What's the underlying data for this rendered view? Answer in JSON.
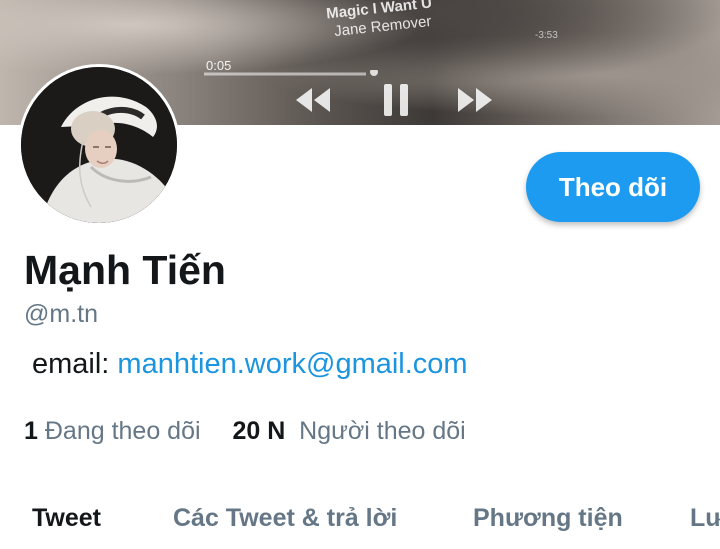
{
  "banner": {
    "song_title": "Magic I Want U",
    "song_artist": "Jane Remover",
    "time_elapsed": "0:05",
    "time_remaining": "-3:53"
  },
  "profile": {
    "name": "Mạnh Tiến",
    "handle": "@m.tn",
    "bio_prefix": "email: ",
    "bio_email": "manhtien.work@gmail.com",
    "follow_label": "Theo dõi"
  },
  "stats": {
    "following_count": "1",
    "following_label": "Đang theo dõi",
    "followers_count": "20 N",
    "followers_label": "Người theo dõi"
  },
  "tabs": [
    {
      "label": "Tweet"
    },
    {
      "label": "Các Tweet & trả lời"
    },
    {
      "label": "Phương tiện"
    },
    {
      "label": "Lượt thích"
    }
  ],
  "colors": {
    "accent": "#1d9bf0",
    "link": "#1b95e0",
    "secondary_text": "#657786",
    "primary_text": "#14171a"
  }
}
